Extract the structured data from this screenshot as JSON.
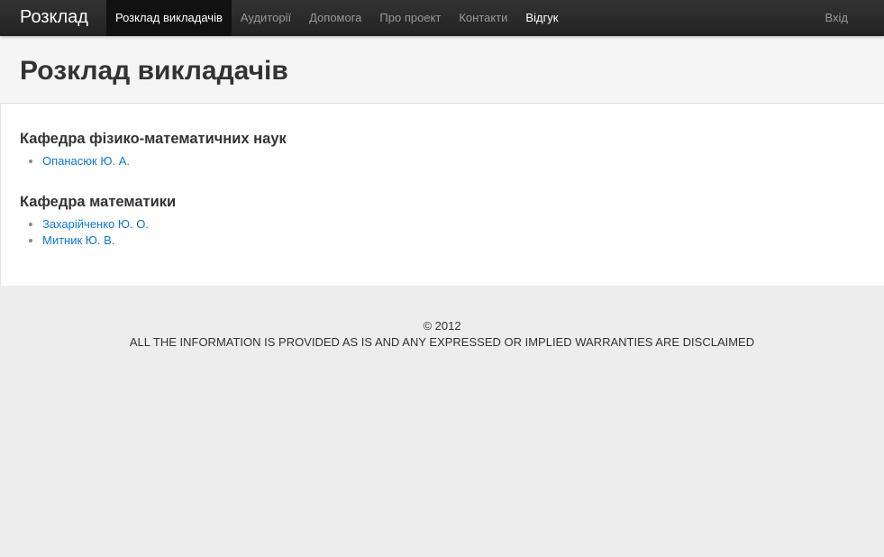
{
  "navbar": {
    "brand": "Розклад",
    "items": [
      {
        "label": "Розклад викладачів",
        "active": true
      },
      {
        "label": "Аудиторії"
      },
      {
        "label": "Допомога"
      },
      {
        "label": "Про проект"
      },
      {
        "label": "Контакти"
      },
      {
        "label": "Відгук"
      }
    ],
    "login": "Вхід"
  },
  "page_title": "Розклад викладачів",
  "departments": [
    {
      "name": "Кафедра фізико-математичних наук",
      "teachers": [
        "Опанасюк Ю. А."
      ]
    },
    {
      "name": "Кафедра математики",
      "teachers": [
        "Захарійченко Ю. О.",
        "Митник Ю. В."
      ]
    }
  ],
  "footer": {
    "copyright": "© 2012",
    "disclaimer": "ALL THE INFORMATION IS PROVIDED AS IS AND ANY EXPRESSED OR IMPLIED WARRANTIES ARE DISCLAIMED"
  }
}
